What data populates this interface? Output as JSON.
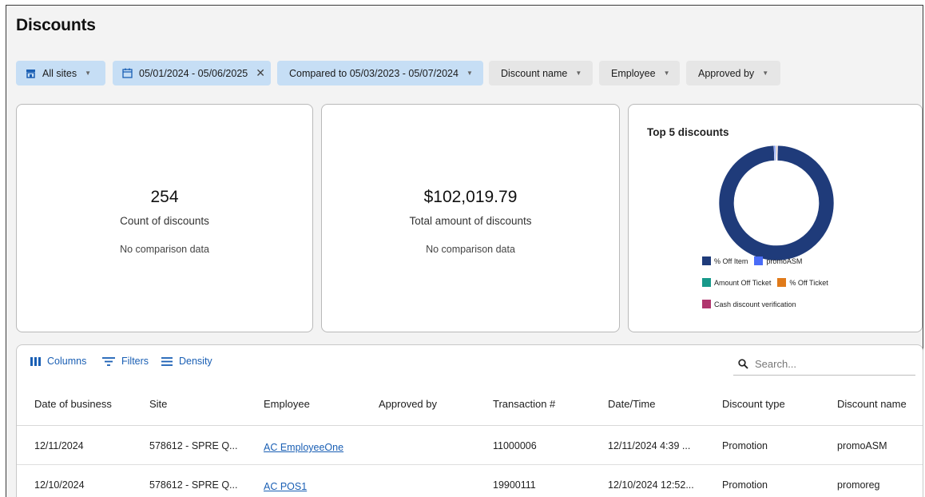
{
  "page": {
    "title": "Discounts"
  },
  "filters": {
    "sites": "All sites",
    "date_range": "05/01/2024 - 05/06/2025",
    "compared": "Compared to 05/03/2023 - 05/07/2024",
    "discount_name": "Discount name",
    "employee": "Employee",
    "approved_by": "Approved by"
  },
  "kpis": [
    {
      "value": "254",
      "label": "Count of discounts",
      "comparison": "No comparison data"
    },
    {
      "value": "$102,019.79",
      "label": "Total amount of discounts",
      "comparison": "No comparison data"
    }
  ],
  "chart_data": {
    "type": "pie",
    "title": "Top 5 discounts",
    "labels": [
      "% Off Item",
      "promoASM",
      "Amount Off Ticket",
      "% Off Ticket",
      "Cash discount verification"
    ],
    "values": [
      99.0,
      0.4,
      0.2,
      0.2,
      0.2
    ],
    "colors": [
      "#1f3b7a",
      "#4a6cf7",
      "#17998a",
      "#e07a1a",
      "#b0356e"
    ],
    "legend": "bottom"
  },
  "grid": {
    "toolbar": {
      "columns": "Columns",
      "filters": "Filters",
      "density": "Density"
    },
    "search_placeholder": "Search...",
    "columns": [
      "Date of business",
      "Site",
      "Employee",
      "Approved by",
      "Transaction #",
      "Date/Time",
      "Discount type",
      "Discount name"
    ],
    "rows": [
      {
        "date": "12/11/2024",
        "site": "578612 - SPRE Q...",
        "employee": "AC EmployeeOne",
        "approved": "",
        "transaction": "11000006",
        "datetime": "12/11/2024 4:39 ...",
        "type": "Promotion",
        "name": "promoASM"
      },
      {
        "date": "12/10/2024",
        "site": "578612 - SPRE Q...",
        "employee": "AC POS1",
        "approved": "",
        "transaction": "19900111",
        "datetime": "12/10/2024 12:52...",
        "type": "Promotion",
        "name": "promoreg"
      }
    ]
  },
  "colors": {
    "chip_blue": "#c6def5",
    "link": "#1a5fb4",
    "donut_main": "#1f3b7a"
  }
}
